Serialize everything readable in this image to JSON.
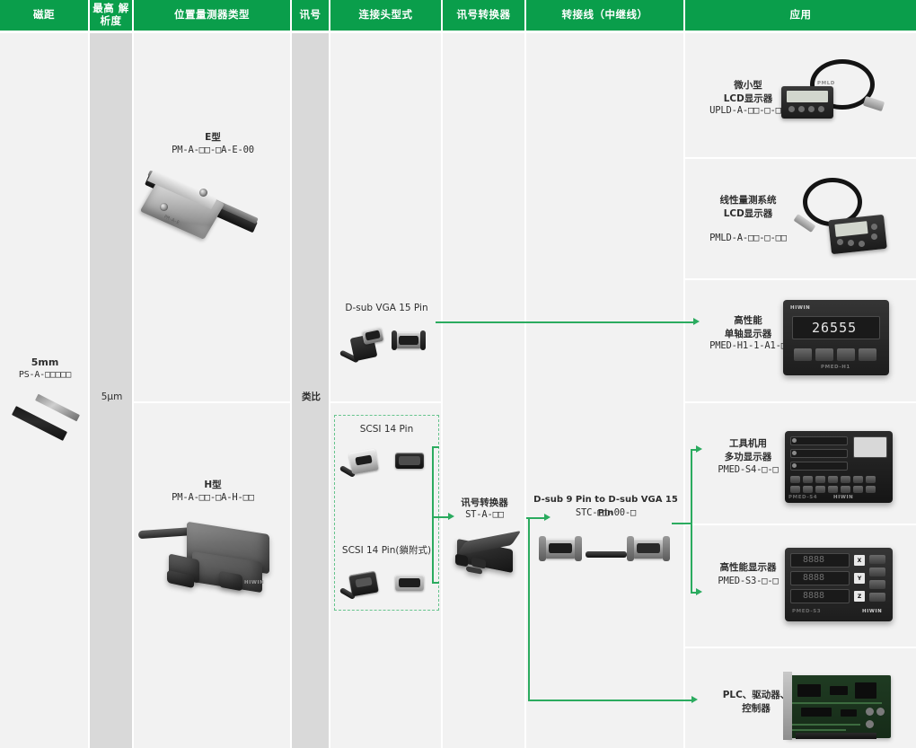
{
  "table": {
    "headers": [
      {
        "id": "pitch",
        "label": "磁距"
      },
      {
        "id": "resolution",
        "label": "最高\n解析度"
      },
      {
        "id": "type",
        "label": "位置量测器类型"
      },
      {
        "id": "signal",
        "label": "讯号"
      },
      {
        "id": "connector",
        "label": "连接头型式"
      },
      {
        "id": "converter",
        "label": "讯号转换器"
      },
      {
        "id": "cable",
        "label": "转接线（中继线）"
      },
      {
        "id": "app",
        "label": "应用"
      }
    ]
  },
  "pitch": {
    "value": "5mm",
    "part_number": "PS-A-□□□□□"
  },
  "resolution": {
    "value": "5μm"
  },
  "sensors": [
    {
      "id": "e-type",
      "name": "E型",
      "part_number": "PM-A-□□-□A-E-00"
    },
    {
      "id": "h-type",
      "name": "H型",
      "part_number": "PM-A-□□-□A-H-□□"
    }
  ],
  "signal": {
    "value": "类比"
  },
  "connectors": [
    {
      "id": "dsub-vga-15",
      "label": "D-sub VGA 15 Pin"
    },
    {
      "id": "scsi-14",
      "label": "SCSI 14 Pin"
    },
    {
      "id": "scsi-14-lock",
      "label": "SCSI 14 Pin(鎖附式)"
    }
  ],
  "converter": {
    "name": "讯号转换器",
    "part_number": "ST-A-□□"
  },
  "cable": {
    "name": "D-sub 9 Pin to D-sub VGA 15 Pin",
    "part_number": "STC-□□-00-□"
  },
  "applications": [
    {
      "id": "upld",
      "name": "微小型\nLCD显示器",
      "part_number": "UPLD-A-□□-□-□□"
    },
    {
      "id": "pmld",
      "name": "线性量测系统\nLCD显示器",
      "part_number": "PMLD-A-□□-□-□□"
    },
    {
      "id": "pmed-h1",
      "name": "高性能\n单轴显示器",
      "part_number": "PMED-H1-1-A1-□"
    },
    {
      "id": "pmed-s4",
      "name": "工具机用\n多功显示器",
      "part_number": "PMED-S4-□-□"
    },
    {
      "id": "pmed-s3",
      "name": "高性能显示器",
      "part_number": "PMED-S3-□-□"
    },
    {
      "id": "plc",
      "name": "PLC、驱动器、\n控制器",
      "part_number": ""
    }
  ],
  "display_readouts": {
    "pmed_h1": "26555",
    "pmed_s3_x": "8888",
    "pmed_s3_y": "8888",
    "pmed_s3_z": "8888",
    "axis_x": "X",
    "axis_y": "Y",
    "axis_z": "Z",
    "brand": "HIWIN"
  },
  "colors": {
    "header_green": "#0a9e4b",
    "arrow_green": "#2bab5f",
    "dash_green": "#66c48d",
    "panel_light": "#f2f2f2",
    "panel_dark": "#d9d9d9"
  }
}
